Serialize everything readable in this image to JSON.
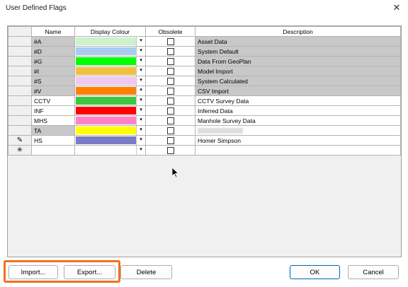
{
  "window": {
    "title": "User Defined Flags",
    "close_label": "✕"
  },
  "table": {
    "headers": [
      "Name",
      "Display Colour",
      "Obsolete",
      "Description"
    ],
    "rows": [
      {
        "code": "#A",
        "color": "#ccf2cc",
        "desc": "Asset Data",
        "kind": "sys"
      },
      {
        "code": "#D",
        "color": "#a8cdf0",
        "desc": "System Default",
        "kind": "sys"
      },
      {
        "code": "#G",
        "color": "#00ff00",
        "desc": "Data From GeoPlan",
        "kind": "sys"
      },
      {
        "code": "#I",
        "color": "#f0c040",
        "desc": "Model Import",
        "kind": "sys"
      },
      {
        "code": "#S",
        "color": "#f0c8f0",
        "desc": "System Calculated",
        "kind": "sys"
      },
      {
        "code": "#V",
        "color": "#ff8000",
        "desc": "CSV Import",
        "kind": "sys"
      },
      {
        "code": "CCTV",
        "color": "#3cc83c",
        "desc": "CCTV Survey Data",
        "kind": "user"
      },
      {
        "code": "INF",
        "color": "#ff0000",
        "desc": "Inferred Data",
        "kind": "user"
      },
      {
        "code": "MHS",
        "color": "#ff82c8",
        "desc": "Manhole Survey Data",
        "kind": "user"
      },
      {
        "code": "TA",
        "color": "#ffff00",
        "desc": "",
        "kind": "user-blur"
      },
      {
        "code": "HS",
        "color": "#7b7bc8",
        "desc": "Homer Simpson",
        "kind": "editing"
      }
    ]
  },
  "buttons": {
    "import": "Import...",
    "export": "Export...",
    "delete": "Delete",
    "ok": "OK",
    "cancel": "Cancel"
  },
  "colors": {
    "highlight": "#f36f21",
    "accent": "#0067c0"
  },
  "icons": {
    "dropdown": "▾",
    "editing": "pencil-icon",
    "new_row": "asterisk-icon"
  }
}
